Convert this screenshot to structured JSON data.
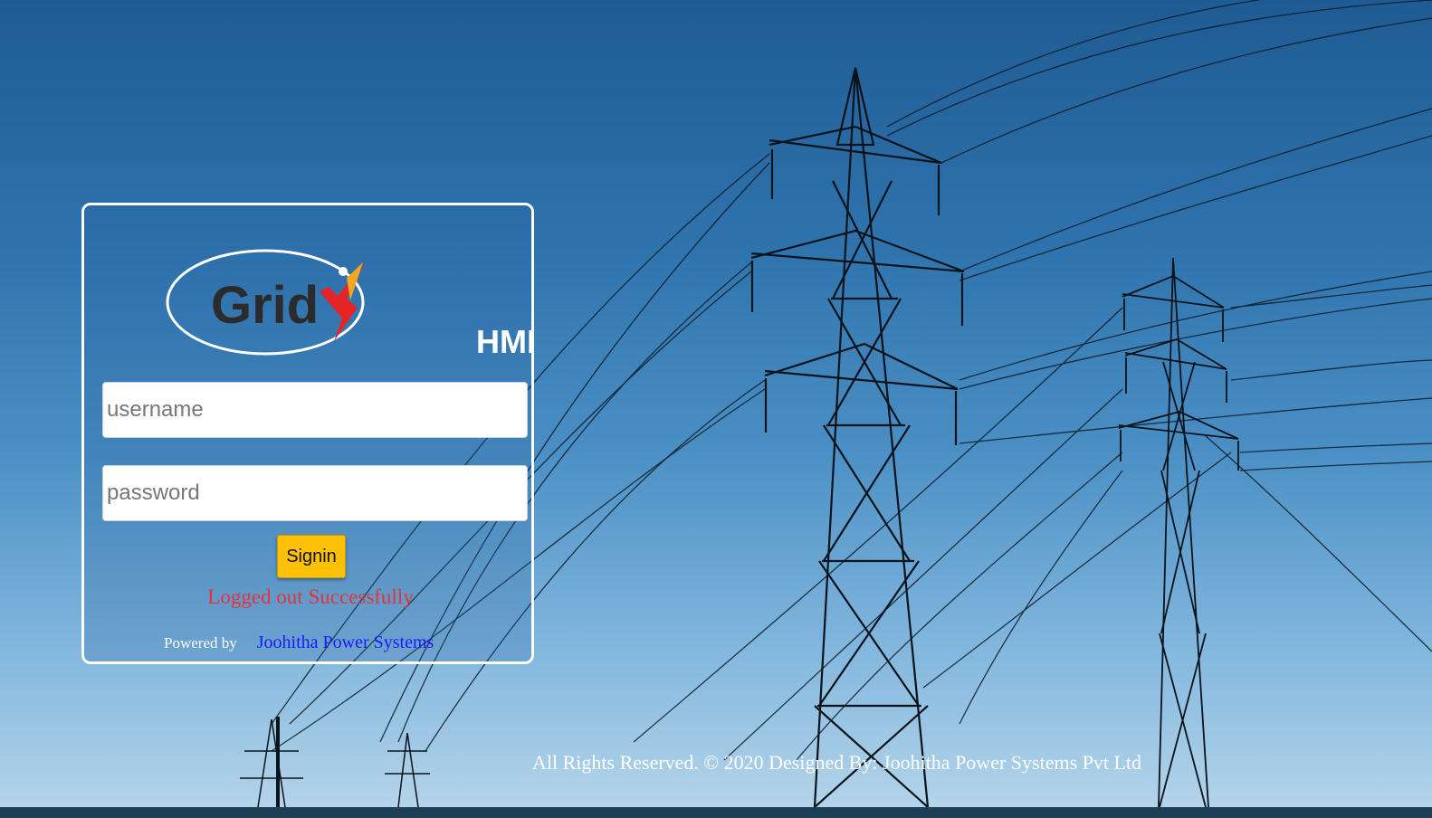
{
  "background": {
    "description_icon": "transmission-towers-image"
  },
  "login": {
    "logo_text": "Grid",
    "logo_suffix": "HMI",
    "username_placeholder": "username",
    "password_placeholder": "password",
    "signin_label": "Signin",
    "status_message": "Logged out Successfully",
    "powered_by_label": "Powered by",
    "powered_by_link": "Joohitha Power Systems"
  },
  "footer": {
    "text": "All Rights Reserved. © 2020 Designed By: Joohitha Power Systems Pvt Ltd"
  },
  "colors": {
    "accent_button": "#ffc107",
    "status_red": "#e5333a",
    "link_blue": "#1a1aff",
    "card_border": "#ffffff"
  }
}
